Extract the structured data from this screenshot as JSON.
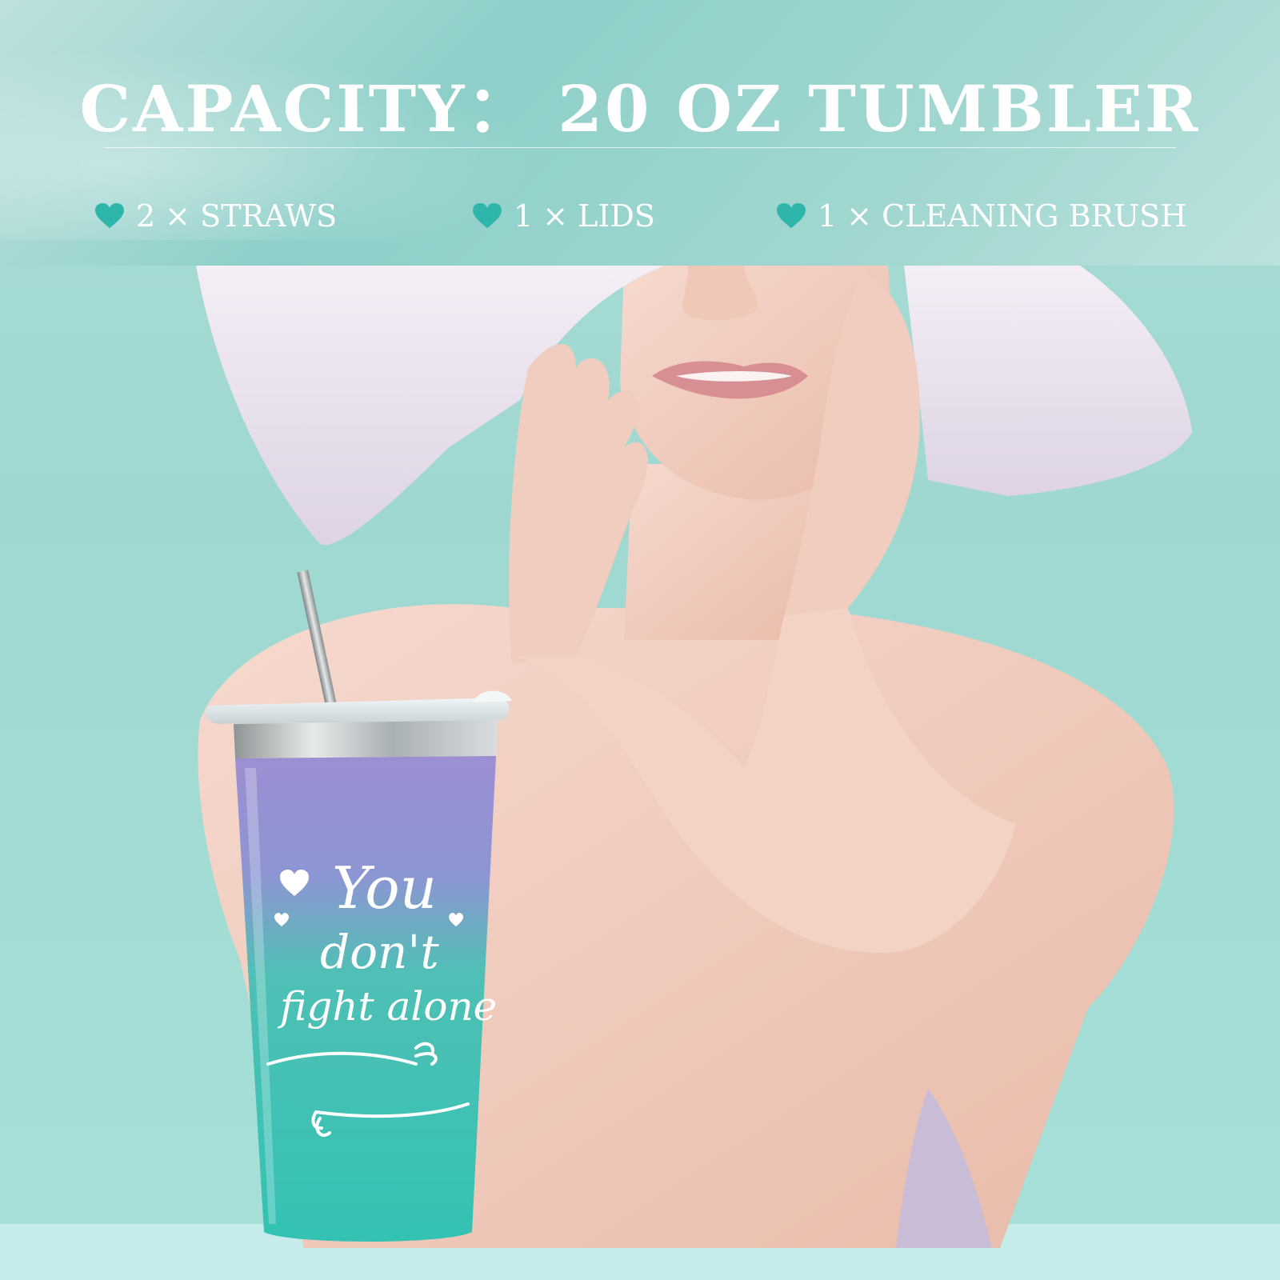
{
  "header": {
    "title": "CAPACITY：  20 OZ TUMBLER",
    "items": [
      {
        "icon": "heart-icon",
        "label": "2 × STRAWS"
      },
      {
        "icon": "heart-icon",
        "label": "1 × LIDS"
      },
      {
        "icon": "heart-icon",
        "label": "1 × CLEANING BRUSH"
      }
    ]
  },
  "tumbler": {
    "line1": "You",
    "line2": "don't",
    "line3": "fight alone"
  },
  "colors": {
    "background": "#a5dcd6",
    "banner": "#8ccec8",
    "heart": "#2fb6ab",
    "tumbler_top": "#9b8fd2",
    "tumbler_bottom": "#33c2b2"
  }
}
